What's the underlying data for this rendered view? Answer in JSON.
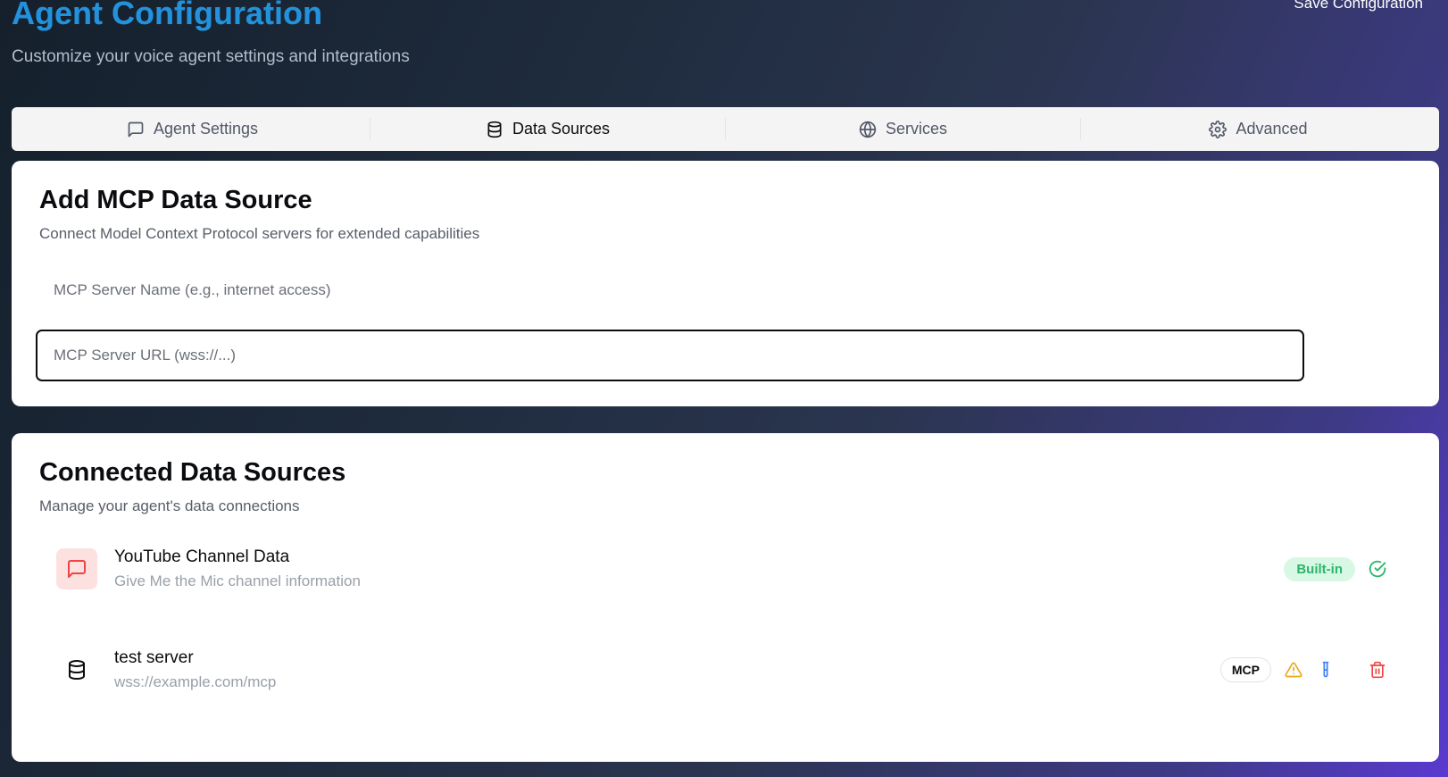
{
  "header": {
    "title": "Agent Configuration",
    "subtitle": "Customize your voice agent settings and integrations",
    "save_label": "Save Configuration"
  },
  "tabs": [
    {
      "label": "Agent Settings",
      "icon": "message-square-icon",
      "active": false
    },
    {
      "label": "Data Sources",
      "icon": "database-icon",
      "active": true
    },
    {
      "label": "Services",
      "icon": "globe-icon",
      "active": false
    },
    {
      "label": "Advanced",
      "icon": "gear-icon",
      "active": false
    }
  ],
  "add_source": {
    "title": "Add MCP Data Source",
    "description": "Connect Model Context Protocol servers for extended capabilities",
    "name_placeholder": "MCP Server Name (e.g., internet access)",
    "name_value": "",
    "url_placeholder": "MCP Server URL (wss://...)",
    "url_value": ""
  },
  "connected": {
    "title": "Connected Data Sources",
    "description": "Manage your agent's data connections",
    "sources": [
      {
        "name": "YouTube Channel Data",
        "detail": "Give Me the Mic channel information",
        "badge": "Built-in",
        "icon": "message-square-icon",
        "status_icon": "check-circle-icon"
      },
      {
        "name": "test server",
        "detail": "wss://example.com/mcp",
        "badge": "MCP",
        "icon": "database-icon",
        "status_icon": "warning-icon"
      }
    ]
  },
  "colors": {
    "accent": "#2391db",
    "builtin_green": "#2bb66a",
    "warning": "#e6a817",
    "test_blue": "#3b82f6",
    "delete_red": "#ef4444"
  }
}
